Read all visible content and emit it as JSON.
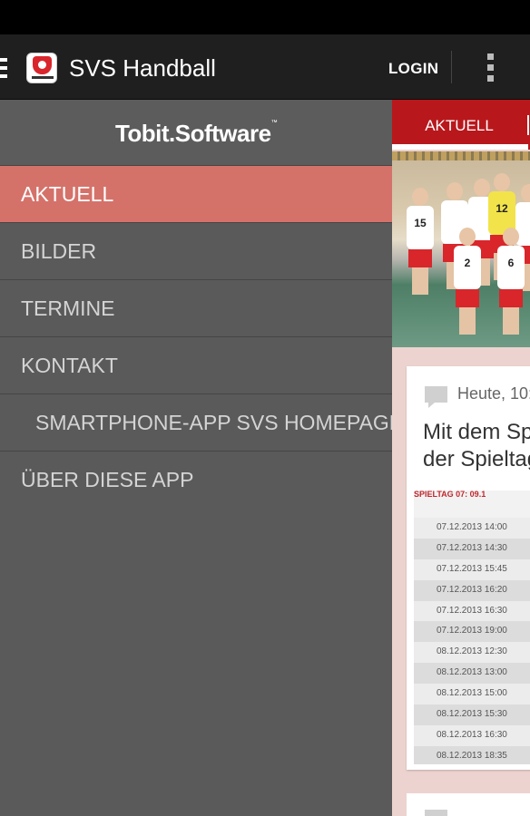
{
  "app": {
    "title": "SVS Handball",
    "logo_icon": "svs-handball-logo-icon"
  },
  "action_bar": {
    "login_label": "LOGIN",
    "overflow_icon": "more-vertical-icon",
    "menu_icon": "hamburger-menu-icon"
  },
  "drawer": {
    "brand": "Tobit.Software",
    "brand_tm": "™",
    "items": [
      {
        "label": "AKTUELL",
        "active": true
      },
      {
        "label": "BILDER"
      },
      {
        "label": "TERMINE"
      },
      {
        "label": "KONTAKT"
      },
      {
        "label": "SMARTPHONE-APP SVS HOMEPAGE",
        "indent": true
      },
      {
        "label": "ÜBER DIESE APP"
      }
    ]
  },
  "content": {
    "tab_label": "AKTUELL",
    "photo_numbers": [
      "15",
      "12",
      "2",
      "6",
      "2",
      "6"
    ],
    "post": {
      "date": "Heute, 10:",
      "headline_line1": "Mit dem Sp",
      "headline_line2": "der Spieltag",
      "schedule_header": "SPIELTAG 07: 09.1",
      "schedule_rows": [
        "07.12.2013 14:00",
        "07.12.2013 14:30",
        "07.12.2013 15:45",
        "07.12.2013 16:20",
        "07.12.2013 16:30",
        "07.12.2013 19:00",
        "08.12.2013 12:30",
        "08.12.2013 13:00",
        "08.12.2013 15:00",
        "08.12.2013 15:30",
        "08.12.2013 16:30",
        "08.12.2013 18:35"
      ]
    }
  },
  "colors": {
    "accent": "#b8181c",
    "active_item": "#d4726a",
    "drawer_bg": "#5a5a5a",
    "action_bar": "#1f1f1f"
  }
}
